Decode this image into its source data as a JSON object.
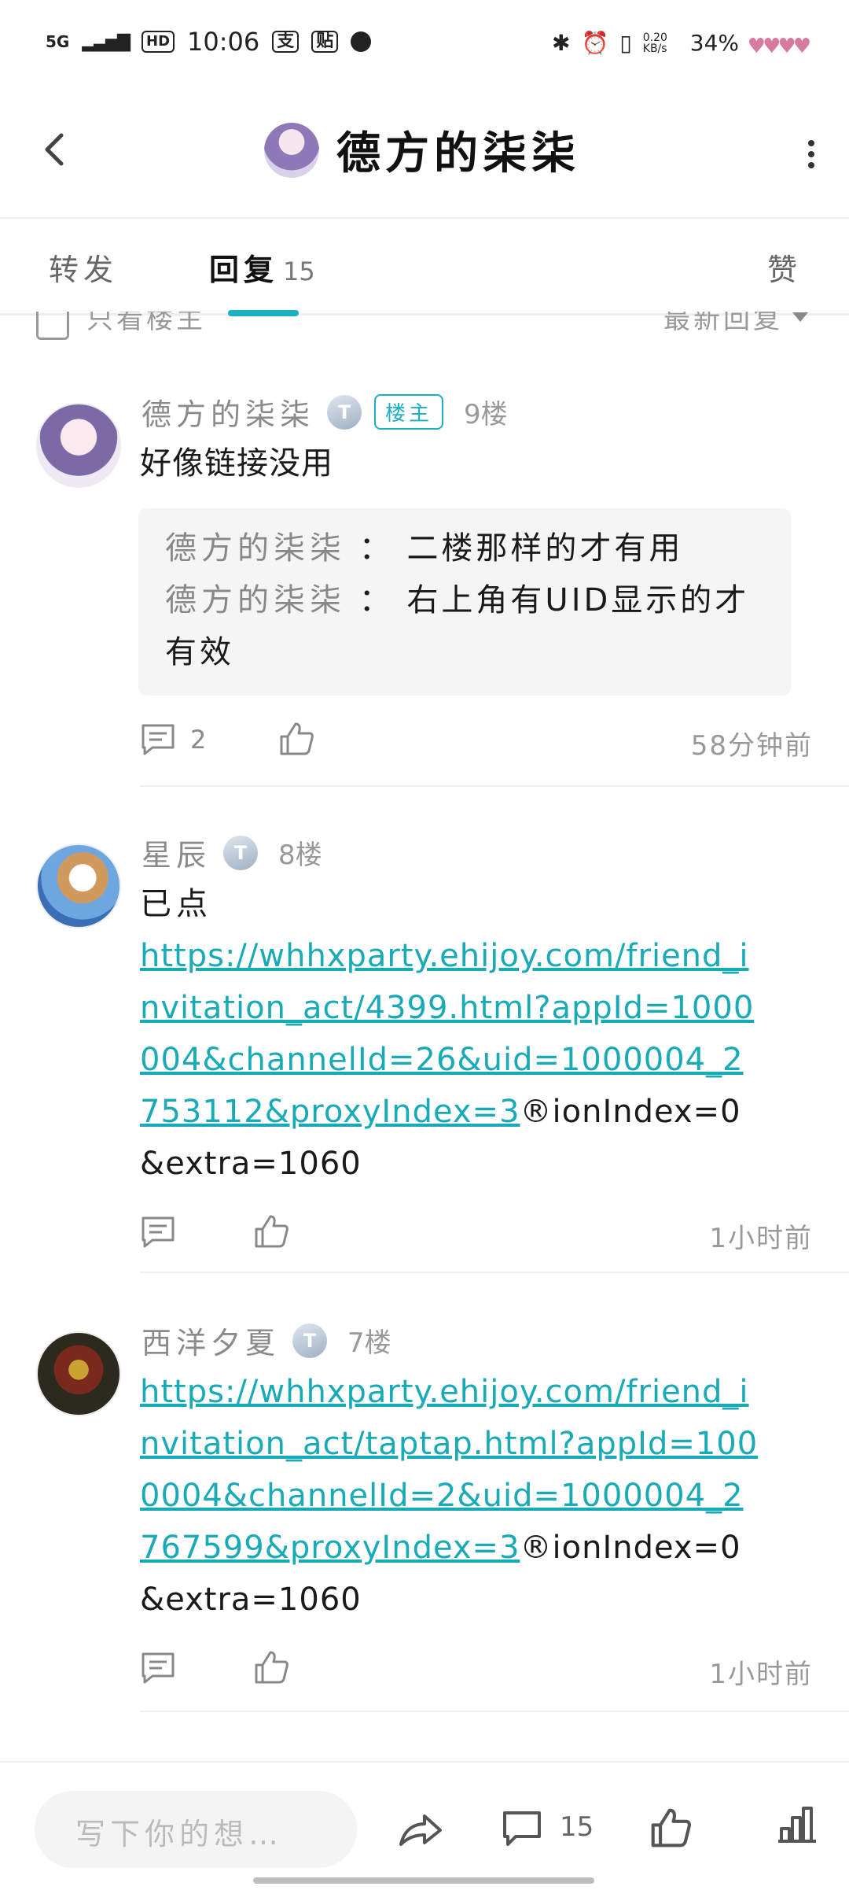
{
  "status_bar": {
    "network": "5G",
    "hd": "HD",
    "time": "10:06",
    "notif_1": "支",
    "notif_2": "贴",
    "speed": "0.20 KB/s",
    "battery": "34%"
  },
  "header": {
    "title": "德方的柒柒"
  },
  "tabs": {
    "forward": "转发",
    "reply": "回复",
    "reply_count": "15",
    "like": "赞"
  },
  "filter": {
    "only_op": "只看楼主",
    "sort": "最新回复"
  },
  "posts": [
    {
      "username": "德方的柒柒",
      "level": "T",
      "badge": "楼主",
      "floor": "9楼",
      "content": "好像链接没用",
      "quotes": [
        {
          "name": "德方的柒柒",
          "sep": "：",
          "text": "二楼那样的才有用"
        },
        {
          "name": "德方的柒柒",
          "sep": "：",
          "text": "右上角有UID显示的才有效"
        }
      ],
      "comment_count": "2",
      "time": "58分钟前"
    },
    {
      "username": "星辰",
      "level": "T",
      "floor": "8楼",
      "content_line1": "已点",
      "link": "https://whhxparty.ehijoy.com/friend_invitation_act/4399.html?appId=1000004&channelId=26&uid=1000004_2753112&proxyIndex=3",
      "tail": "®ionIndex=0&extra=1060",
      "time": "1小时前"
    },
    {
      "username": "西洋夕夏",
      "level": "T",
      "floor": "7楼",
      "link": "https://whhxparty.ehijoy.com/friend_invitation_act/taptap.html?appId=1000004&channelId=2&uid=1000004_2767599&proxyIndex=3",
      "tail": "®ionIndex=0&extra=1060",
      "time": "1小时前"
    }
  ],
  "bottom_bar": {
    "placeholder": "写下你的想…",
    "comment_count": "15"
  },
  "colors": {
    "accent": "#19b0c4",
    "link": "#19aab8"
  }
}
